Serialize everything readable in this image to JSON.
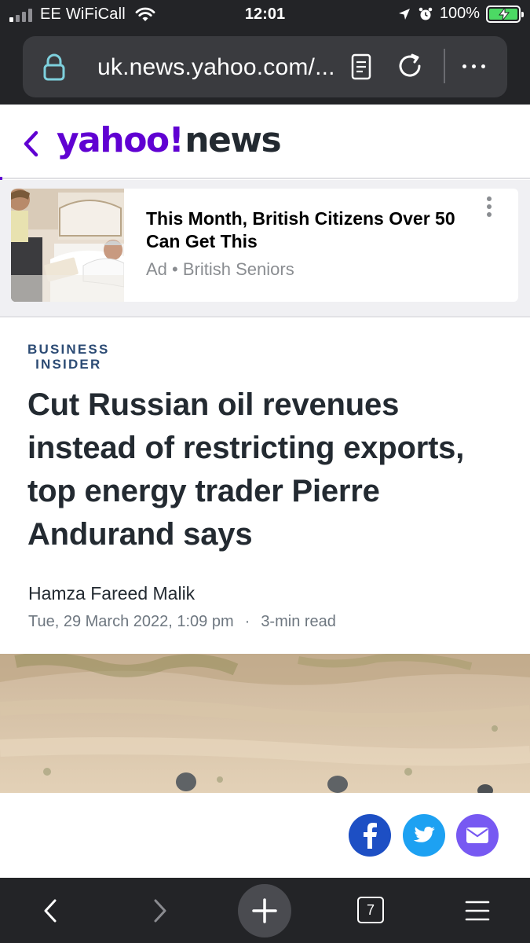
{
  "status_bar": {
    "carrier": "EE WiFiCall",
    "time": "12:01",
    "battery": "100%"
  },
  "browser": {
    "url": "uk.news.yahoo.com/...",
    "tab_count": "7"
  },
  "header": {
    "logo_yahoo": "yahoo!",
    "logo_news": "news"
  },
  "ad": {
    "title": "This Month, British Citizens Over 50 Can Get This",
    "label": "Ad",
    "sponsor": "British Seniors"
  },
  "article": {
    "publisher_line1": "BUSINESS",
    "publisher_line2": "INSIDER",
    "headline": "Cut Russian oil revenues instead of restricting exports, top energy trader Pierre Andurand says",
    "author": "Hamza Fareed Malik",
    "date": "Tue, 29 March 2022, 1:09 pm",
    "read_time": "3-min read"
  },
  "icons": {
    "share": [
      "facebook-icon",
      "twitter-icon",
      "mail-icon"
    ]
  },
  "colors": {
    "brand_purple": "#6001d2",
    "headline": "#232a31",
    "publisher": "#2c4b74",
    "facebook": "#1d4fc4",
    "twitter": "#1da1f2",
    "mail": "#7759f2",
    "chrome": "#232427"
  }
}
